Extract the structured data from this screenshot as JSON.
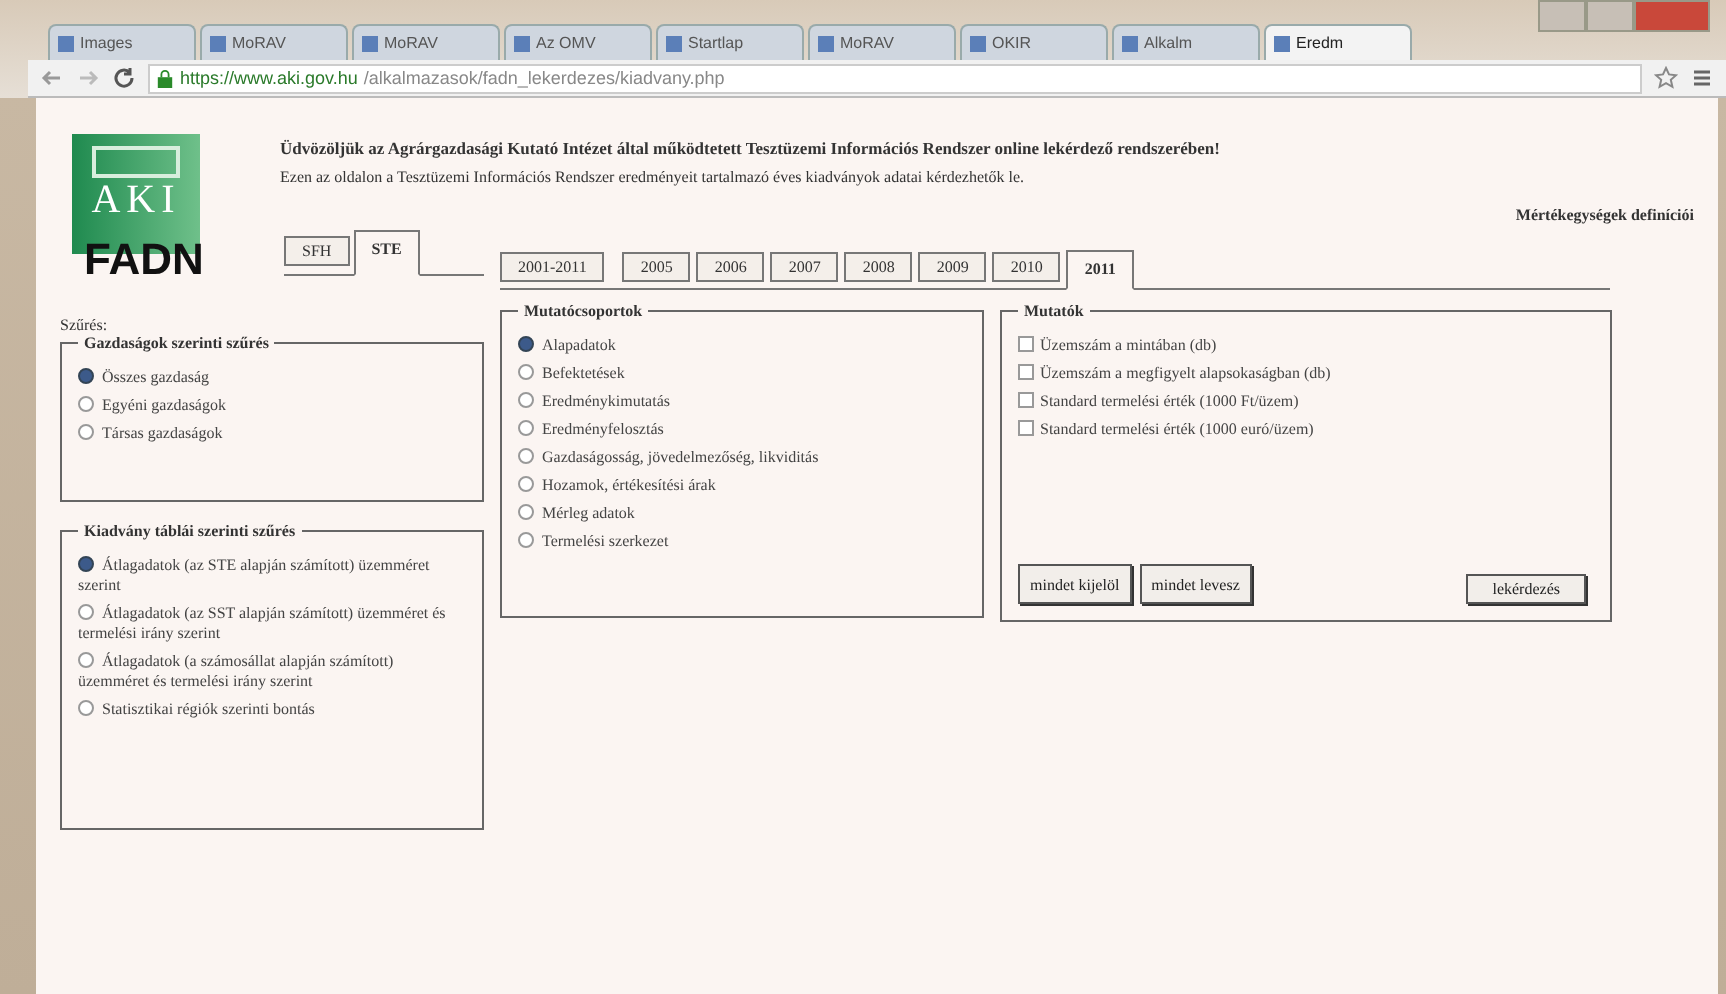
{
  "browser": {
    "tabs": [
      {
        "label": "Images",
        "selected": false
      },
      {
        "label": "MoRAV",
        "selected": false
      },
      {
        "label": "MoRAV",
        "selected": false
      },
      {
        "label": "Az OMV",
        "selected": false
      },
      {
        "label": "Startlap",
        "selected": false
      },
      {
        "label": "MoRAV",
        "selected": false
      },
      {
        "label": "OKIR",
        "selected": false
      },
      {
        "label": "Alkalm",
        "selected": false
      },
      {
        "label": "Eredm",
        "selected": true
      }
    ],
    "url_host": "https://www.aki.gov.hu",
    "url_path": "/alkalmazasok/fadn_lekerdezes/kiadvany.php"
  },
  "logo": {
    "top": "AKI",
    "bottom": "FADN"
  },
  "header": {
    "title": "Üdvözöljük az Agrárgazdasági Kutató Intézet által működtetett Tesztüzemi Információs Rendszer online lekérdező rendszerében!",
    "subtitle": "Ezen az oldalon a Tesztüzemi Információs Rendszer eredményeit tartalmazó éves kiadványok adatai kérdezhetők le.",
    "definitions_link": "Mértékegységek definíciói"
  },
  "main_tabs": [
    {
      "label": "SFH",
      "selected": false
    },
    {
      "label": "STE",
      "selected": true
    }
  ],
  "year_tabs": [
    {
      "label": "2001-2011",
      "selected": false
    },
    {
      "label": "2005",
      "selected": false
    },
    {
      "label": "2006",
      "selected": false
    },
    {
      "label": "2007",
      "selected": false
    },
    {
      "label": "2008",
      "selected": false
    },
    {
      "label": "2009",
      "selected": false
    },
    {
      "label": "2010",
      "selected": false
    },
    {
      "label": "2011",
      "selected": true
    }
  ],
  "filter_label": "Szűrés:",
  "farm_filter": {
    "legend": "Gazdaságok szerinti szűrés",
    "options": [
      {
        "label": "Összes gazdaság",
        "selected": true
      },
      {
        "label": "Egyéni gazdaságok",
        "selected": false
      },
      {
        "label": "Társas gazdaságok",
        "selected": false
      }
    ]
  },
  "table_filter": {
    "legend": "Kiadvány táblái szerinti szűrés",
    "options": [
      {
        "label": "Átlagadatok (az STE alapján számított) üzemméret szerint",
        "selected": true
      },
      {
        "label": "Átlagadatok (az SST alapján számított) üzemméret és termelési irány szerint",
        "selected": false
      },
      {
        "label": "Átlagadatok (a számosállat alapján számított) üzemméret és termelési irány szerint",
        "selected": false
      },
      {
        "label": "Statisztikai régiók szerinti bontás",
        "selected": false
      }
    ]
  },
  "indicator_groups": {
    "legend": "Mutatócsoportok",
    "options": [
      {
        "label": "Alapadatok",
        "selected": true
      },
      {
        "label": "Befektetések",
        "selected": false
      },
      {
        "label": "Eredménykimutatás",
        "selected": false
      },
      {
        "label": "Eredményfelosztás",
        "selected": false
      },
      {
        "label": "Gazdaságosság, jövedelmezőség, likviditás",
        "selected": false
      },
      {
        "label": "Hozamok, értékesítési árak",
        "selected": false
      },
      {
        "label": "Mérleg adatok",
        "selected": false
      },
      {
        "label": "Termelési szerkezet",
        "selected": false
      }
    ]
  },
  "indicators": {
    "legend": "Mutatók",
    "options": [
      {
        "label": "Üzemszám a mintában (db)",
        "checked": false
      },
      {
        "label": "Üzemszám a megfigyelt alapsokaságban (db)",
        "checked": false
      },
      {
        "label": "Standard termelési érték (1000 Ft/üzem)",
        "checked": false
      },
      {
        "label": "Standard termelési érték (1000 euró/üzem)",
        "checked": false
      }
    ],
    "buttons": [
      "mindet kijelöl",
      "mindet levesz"
    ],
    "submit": "lekérdezés"
  }
}
